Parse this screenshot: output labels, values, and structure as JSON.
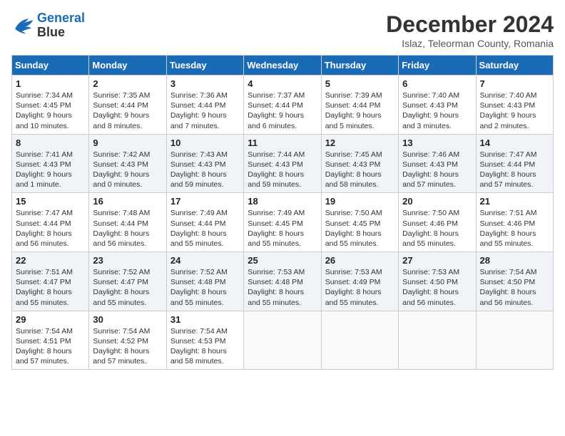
{
  "logo": {
    "line1": "General",
    "line2": "Blue"
  },
  "title": "December 2024",
  "subtitle": "Islaz, Teleorman County, Romania",
  "weekdays": [
    "Sunday",
    "Monday",
    "Tuesday",
    "Wednesday",
    "Thursday",
    "Friday",
    "Saturday"
  ],
  "weeks": [
    [
      {
        "day": "1",
        "sunrise": "7:34 AM",
        "sunset": "4:45 PM",
        "daylight": "9 hours and 10 minutes."
      },
      {
        "day": "2",
        "sunrise": "7:35 AM",
        "sunset": "4:44 PM",
        "daylight": "9 hours and 8 minutes."
      },
      {
        "day": "3",
        "sunrise": "7:36 AM",
        "sunset": "4:44 PM",
        "daylight": "9 hours and 7 minutes."
      },
      {
        "day": "4",
        "sunrise": "7:37 AM",
        "sunset": "4:44 PM",
        "daylight": "9 hours and 6 minutes."
      },
      {
        "day": "5",
        "sunrise": "7:39 AM",
        "sunset": "4:44 PM",
        "daylight": "9 hours and 5 minutes."
      },
      {
        "day": "6",
        "sunrise": "7:40 AM",
        "sunset": "4:43 PM",
        "daylight": "9 hours and 3 minutes."
      },
      {
        "day": "7",
        "sunrise": "7:40 AM",
        "sunset": "4:43 PM",
        "daylight": "9 hours and 2 minutes."
      }
    ],
    [
      {
        "day": "8",
        "sunrise": "7:41 AM",
        "sunset": "4:43 PM",
        "daylight": "9 hours and 1 minute."
      },
      {
        "day": "9",
        "sunrise": "7:42 AM",
        "sunset": "4:43 PM",
        "daylight": "9 hours and 0 minutes."
      },
      {
        "day": "10",
        "sunrise": "7:43 AM",
        "sunset": "4:43 PM",
        "daylight": "8 hours and 59 minutes."
      },
      {
        "day": "11",
        "sunrise": "7:44 AM",
        "sunset": "4:43 PM",
        "daylight": "8 hours and 59 minutes."
      },
      {
        "day": "12",
        "sunrise": "7:45 AM",
        "sunset": "4:43 PM",
        "daylight": "8 hours and 58 minutes."
      },
      {
        "day": "13",
        "sunrise": "7:46 AM",
        "sunset": "4:43 PM",
        "daylight": "8 hours and 57 minutes."
      },
      {
        "day": "14",
        "sunrise": "7:47 AM",
        "sunset": "4:44 PM",
        "daylight": "8 hours and 57 minutes."
      }
    ],
    [
      {
        "day": "15",
        "sunrise": "7:47 AM",
        "sunset": "4:44 PM",
        "daylight": "8 hours and 56 minutes."
      },
      {
        "day": "16",
        "sunrise": "7:48 AM",
        "sunset": "4:44 PM",
        "daylight": "8 hours and 56 minutes."
      },
      {
        "day": "17",
        "sunrise": "7:49 AM",
        "sunset": "4:44 PM",
        "daylight": "8 hours and 55 minutes."
      },
      {
        "day": "18",
        "sunrise": "7:49 AM",
        "sunset": "4:45 PM",
        "daylight": "8 hours and 55 minutes."
      },
      {
        "day": "19",
        "sunrise": "7:50 AM",
        "sunset": "4:45 PM",
        "daylight": "8 hours and 55 minutes."
      },
      {
        "day": "20",
        "sunrise": "7:50 AM",
        "sunset": "4:46 PM",
        "daylight": "8 hours and 55 minutes."
      },
      {
        "day": "21",
        "sunrise": "7:51 AM",
        "sunset": "4:46 PM",
        "daylight": "8 hours and 55 minutes."
      }
    ],
    [
      {
        "day": "22",
        "sunrise": "7:51 AM",
        "sunset": "4:47 PM",
        "daylight": "8 hours and 55 minutes."
      },
      {
        "day": "23",
        "sunrise": "7:52 AM",
        "sunset": "4:47 PM",
        "daylight": "8 hours and 55 minutes."
      },
      {
        "day": "24",
        "sunrise": "7:52 AM",
        "sunset": "4:48 PM",
        "daylight": "8 hours and 55 minutes."
      },
      {
        "day": "25",
        "sunrise": "7:53 AM",
        "sunset": "4:48 PM",
        "daylight": "8 hours and 55 minutes."
      },
      {
        "day": "26",
        "sunrise": "7:53 AM",
        "sunset": "4:49 PM",
        "daylight": "8 hours and 55 minutes."
      },
      {
        "day": "27",
        "sunrise": "7:53 AM",
        "sunset": "4:50 PM",
        "daylight": "8 hours and 56 minutes."
      },
      {
        "day": "28",
        "sunrise": "7:54 AM",
        "sunset": "4:50 PM",
        "daylight": "8 hours and 56 minutes."
      }
    ],
    [
      {
        "day": "29",
        "sunrise": "7:54 AM",
        "sunset": "4:51 PM",
        "daylight": "8 hours and 57 minutes."
      },
      {
        "day": "30",
        "sunrise": "7:54 AM",
        "sunset": "4:52 PM",
        "daylight": "8 hours and 57 minutes."
      },
      {
        "day": "31",
        "sunrise": "7:54 AM",
        "sunset": "4:53 PM",
        "daylight": "8 hours and 58 minutes."
      },
      null,
      null,
      null,
      null
    ]
  ]
}
